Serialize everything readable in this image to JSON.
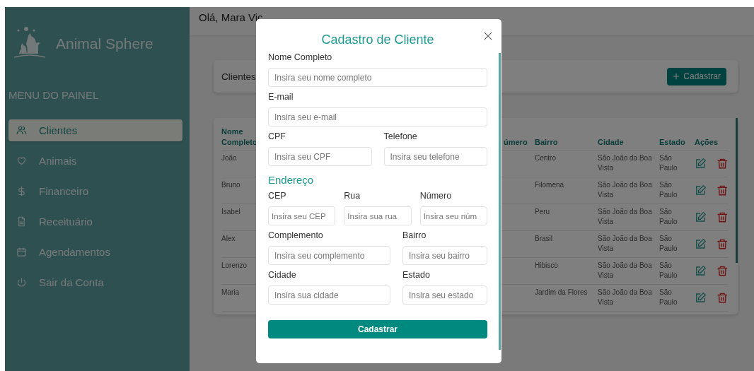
{
  "sidebar": {
    "brand": "Animal Sphere",
    "menu_title": "MENU DO PAINEL",
    "items": [
      {
        "label": "Clientes",
        "selected": true
      },
      {
        "label": "Animais",
        "selected": false
      },
      {
        "label": "Financeiro",
        "selected": false
      },
      {
        "label": "Receituário",
        "selected": false
      },
      {
        "label": "Agendamentos",
        "selected": false
      },
      {
        "label": "Sair da Conta",
        "selected": false
      }
    ]
  },
  "header": {
    "greeting": "Olá, Mara Vic"
  },
  "toolbar": {
    "title": "Clientes",
    "button": "Cadastrar"
  },
  "table": {
    "columns": [
      {
        "kind": "name",
        "label": "Nome Completo"
      },
      {
        "kind": "number",
        "label": "úmero"
      },
      {
        "kind": "text",
        "label": "Bairro"
      },
      {
        "kind": "text",
        "label": "Cidade"
      },
      {
        "kind": "text",
        "label": "Estado"
      },
      {
        "kind": "actions",
        "label": "Ações"
      }
    ],
    "rows": [
      {
        "name": "João",
        "bairro": "Centro",
        "cidade": "São João da Boa Vista",
        "estado": "São Paulo"
      },
      {
        "name": "Bruno",
        "bairro": "Filomena",
        "cidade": "São João da Boa Vista",
        "estado": "São Paulo"
      },
      {
        "name": "Isabel",
        "bairro": "Peru",
        "cidade": "São João da Boa Vista",
        "estado": "São Paulo"
      },
      {
        "name": "Alex",
        "bairro": "Brasil",
        "cidade": "São João da Boa Vista",
        "estado": "São Paulo"
      },
      {
        "name": "Lorenzo",
        "bairro": "Hibisco",
        "cidade": "São João da Boa Vista",
        "estado": "São Paulo"
      },
      {
        "name": "Maria",
        "bairro": "Jardim da Flores",
        "cidade": "São João da Boa Vista",
        "estado": "São Paulo"
      }
    ]
  },
  "modal": {
    "title": "Cadastro de Cliente",
    "rows": [
      {
        "kind": "single",
        "fields": [
          {
            "label": "Nome Completo",
            "placeholder": "Insira seu nome completo"
          }
        ]
      },
      {
        "kind": "single",
        "fields": [
          {
            "label": "E-mail",
            "placeholder": "Insira seu e-mail"
          }
        ]
      },
      {
        "kind": "pair",
        "fields": [
          {
            "label": "CPF",
            "placeholder": "Insira seu CPF"
          },
          {
            "label": "Telefone",
            "placeholder": "Insira seu telefone"
          }
        ]
      },
      {
        "kind": "heading",
        "text": "Endereço"
      },
      {
        "kind": "triple",
        "fields": [
          {
            "label": "CEP",
            "placeholder": "Insira seu CEP"
          },
          {
            "label": "Rua",
            "placeholder": "Insira sua rua"
          },
          {
            "label": "Número",
            "placeholder": "Insira seu núm"
          }
        ]
      },
      {
        "kind": "split",
        "fields": [
          {
            "label": "Complemento",
            "placeholder": "Insira seu complemento"
          },
          {
            "label": "Bairro",
            "placeholder": "Insira seu bairro"
          }
        ]
      },
      {
        "kind": "split",
        "fields": [
          {
            "label": "Cidade",
            "placeholder": "Insira sua cidade"
          },
          {
            "label": "Estado",
            "placeholder": "Insira seu estado"
          }
        ]
      }
    ],
    "submit": "Cadastrar"
  }
}
